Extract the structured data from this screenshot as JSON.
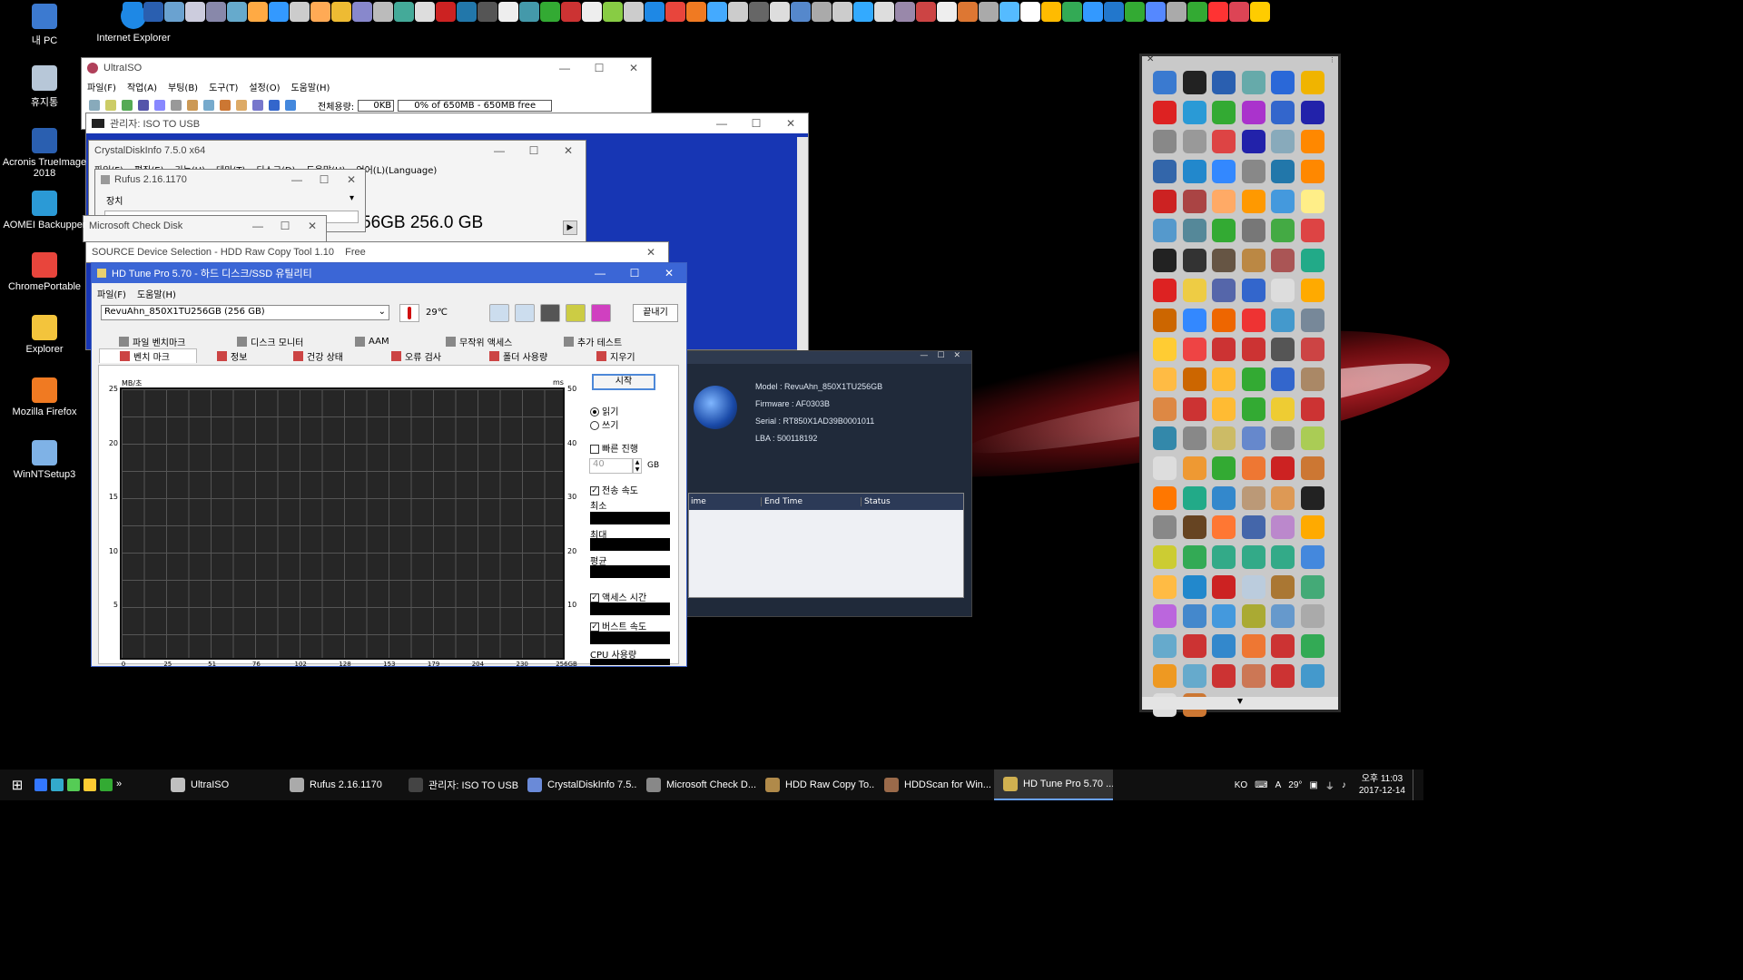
{
  "desktop": {
    "icons": [
      {
        "label": "내 PC",
        "color": "#3c7ad0"
      },
      {
        "label": "휴지통",
        "color": "#b7c7d8"
      },
      {
        "label": "Acronis TrueImage 2018",
        "color": "#2a5fb0"
      },
      {
        "label": "AOMEI Backupper",
        "color": "#2b9ad6"
      },
      {
        "label": "ChromePortable",
        "color": "#e8453c"
      },
      {
        "label": "Explorer",
        "color": "#f3c43c"
      },
      {
        "label": "Mozilla Firefox",
        "color": "#f07a22"
      },
      {
        "label": "WinNTSetup3",
        "color": "#7fb2e6"
      }
    ],
    "ie_label": "Internet Explorer"
  },
  "ultraiso": {
    "title": "UltraISO",
    "menu": [
      "파일(F)",
      "작업(A)",
      "부팅(B)",
      "도구(T)",
      "설정(O)",
      "도움말(H)"
    ],
    "capacity_label": "전체용량:",
    "capacity_value": "0KB",
    "capacity_bar": "0% of 650MB - 650MB free"
  },
  "iso_to_usb": {
    "title": "관리자:  ISO TO USB"
  },
  "crystaldisk": {
    "title": "CrystalDiskInfo 7.5.0 x64",
    "menu": [
      "파일(F)",
      "편집(E)",
      "기능(U)",
      "테마(T)",
      "디스크(D)",
      "도움말(H)",
      "언어(L)(Language)"
    ],
    "disk_line": "56GB 256.0 GB"
  },
  "rufus": {
    "title": "Rufus 2.16.1170",
    "device_label": "장치"
  },
  "checkdisk": {
    "title": "Microsoft Check Disk"
  },
  "hddraw": {
    "title": "SOURCE Device Selection - HDD Raw Copy Tool 1.10    Free"
  },
  "hddscan": {
    "model": "Model : RevuAhn_850X1TU256GB",
    "firmware": "Firmware : AF0303B",
    "serial": "Serial : RT850X1AD39B0001011",
    "lba": "LBA : 500118192",
    "columns": [
      "ime",
      "End Time",
      "Status"
    ]
  },
  "hdtune": {
    "title": "HD Tune Pro 5.70 - 하드 디스크/SSD 유틸리티",
    "menu": [
      "파일(F)",
      "도움말(H)"
    ],
    "drive": "RevuAhn_850X1TU256GB (256 GB)",
    "temperature": "29℃",
    "exit_button": "끝내기",
    "tabs_row1": [
      "파일 벤치마크",
      "디스크 모니터",
      "AAM",
      "무작위 액세스",
      "추가 테스트"
    ],
    "tabs_row2": [
      "벤치 마크",
      "정보",
      "건강 상태",
      "오류 검사",
      "폴더 사용량",
      "지우기"
    ],
    "start_button": "시작",
    "read_label": "읽기",
    "write_label": "쓰기",
    "fast_label": "빠른 진행",
    "gb_value": "40",
    "gb_unit": "GB",
    "transfer_label": "전송 속도",
    "min_label": "최소",
    "max_label": "최대",
    "avg_label": "평균",
    "access_label": "액세스 시간",
    "burst_label": "버스트 속도",
    "cpu_label": "CPU 사용량",
    "y_unit_left": "MB/초",
    "y_unit_right": "ms"
  },
  "chart_data": {
    "type": "line",
    "ylabel": "MB/초",
    "ylabel_right": "ms",
    "ylim": [
      0,
      25
    ],
    "ylim_right": [
      0,
      50
    ],
    "yticks_left": [
      "25",
      "20",
      "15",
      "10",
      "5"
    ],
    "yticks_right": [
      "50",
      "40",
      "30",
      "20",
      "10"
    ],
    "xticks": [
      "0",
      "25",
      "51",
      "76",
      "102",
      "128",
      "153",
      "179",
      "204",
      "230",
      "256GB"
    ],
    "series": [],
    "grid": true
  },
  "taskbar": {
    "items": [
      {
        "label": "UltraISO",
        "color": "#c0c0c0"
      },
      {
        "label": "Rufus 2.16.1170",
        "color": "#aaaaaa"
      },
      {
        "label": "관리자:  ISO TO USB",
        "color": "#444444"
      },
      {
        "label": "CrystalDiskInfo 7.5...",
        "color": "#6a8ad8"
      },
      {
        "label": "Microsoft Check D...",
        "color": "#888888"
      },
      {
        "label": "HDD Raw Copy To...",
        "color": "#b08a4a"
      },
      {
        "label": "HDDScan for Win...",
        "color": "#9a6a4a"
      },
      {
        "label": "HD Tune Pro 5.70 ...",
        "color": "#d0b050"
      }
    ],
    "tray_lang": "KO",
    "tray_ime": "A",
    "tray_temp": "29°",
    "time": "오후 11:03",
    "date": "2017-12-14"
  }
}
